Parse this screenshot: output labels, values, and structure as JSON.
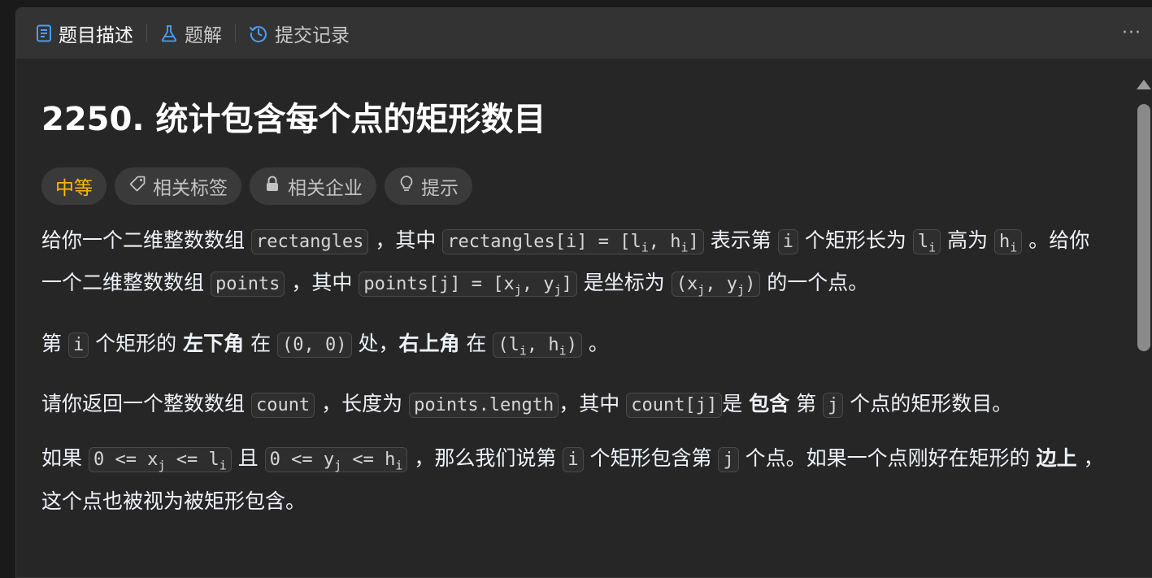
{
  "tabs": [
    {
      "label": "题目描述",
      "icon": "description-icon",
      "active": true
    },
    {
      "label": "题解",
      "icon": "flask-icon",
      "active": false
    },
    {
      "label": "提交记录",
      "icon": "history-icon",
      "active": false
    }
  ],
  "more_label": "···",
  "problem": {
    "title": "2250. 统计包含每个点的矩形数目",
    "difficulty": "中等",
    "tags": [
      {
        "label": "相关标签",
        "icon": "tag-icon"
      },
      {
        "label": "相关企业",
        "icon": "lock-icon"
      },
      {
        "label": "提示",
        "icon": "lightbulb-icon"
      }
    ]
  },
  "desc": {
    "p1": {
      "t1": "给你一个二维整数数组 ",
      "c1": "rectangles",
      "t2": " ，其中 ",
      "c2a": "rectangles[i] = [l",
      "c2s1": "i",
      "c2b": ", h",
      "c2s2": "i",
      "c2c": "]",
      "t3": " 表示第 ",
      "c3": "i",
      "t4": " 个矩形长为 ",
      "c4a": "l",
      "c4s": "i",
      "t5": " 高为 ",
      "c5a": "h",
      "c5s": "i",
      "t6": " 。给你一个二维整数数组 ",
      "c6": "points",
      "t7": " ，其中 ",
      "c7a": "points[j] = [x",
      "c7s1": "j",
      "c7b": ", y",
      "c7s2": "j",
      "c7c": "]",
      "t8": " 是坐标为 ",
      "c8a": "(x",
      "c8s1": "j",
      "c8b": ", y",
      "c8s2": "j",
      "c8c": ")",
      "t9": " 的一个点。"
    },
    "p2": {
      "t1": "第 ",
      "c1": "i",
      "t2": " 个矩形的 ",
      "b1": "左下角",
      "t3": " 在 ",
      "c2": "(0, 0)",
      "t4": " 处，",
      "b2": "右上角",
      "t5": " 在 ",
      "c3a": "(l",
      "c3s1": "i",
      "c3b": ", h",
      "c3s2": "i",
      "c3c": ")",
      "t6": " 。"
    },
    "p3": {
      "t1": "请你返回一个整数数组 ",
      "c1": "count",
      "t2": " ，长度为 ",
      "c2": "points.length",
      "t3": "，其中 ",
      "c3": "count[j]",
      "t4": "是 ",
      "b1": "包含",
      "t5": " 第 ",
      "c4": "j",
      "t6": " 个点的矩形数目。"
    },
    "p4": {
      "t1": "如果 ",
      "c1a": "0 <= x",
      "c1s1": "j",
      "c1b": " <= l",
      "c1s2": "i",
      "t2": " 且 ",
      "c2a": "0 <= y",
      "c2s1": "j",
      "c2b": " <= h",
      "c2s2": "i",
      "t3": " ，那么我们说第 ",
      "c3": "i",
      "t4": " 个矩形包含第 ",
      "c4": "j",
      "t5": " 个点。如果一个点刚好在矩形的 ",
      "b1": "边上",
      "t6": " ，这个点也被视为被矩形包含。"
    }
  },
  "colors": {
    "accent_blue": "#4a9ff5",
    "difficulty_medium": "#ffb800",
    "panel_bg": "#262626",
    "tabbar_bg": "#333333"
  }
}
